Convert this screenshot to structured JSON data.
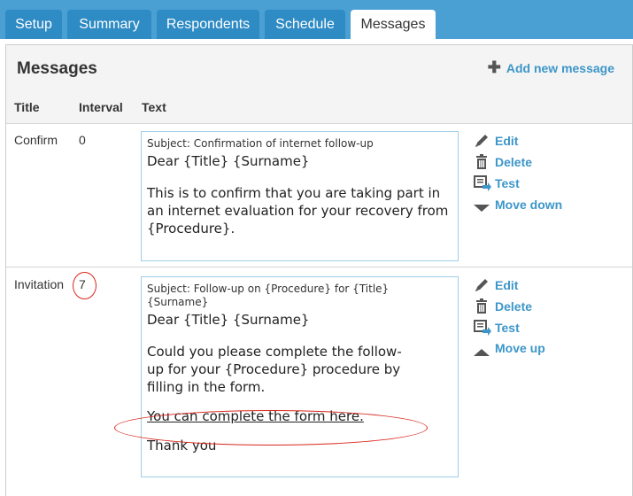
{
  "tabs": [
    {
      "label": "Setup"
    },
    {
      "label": "Summary"
    },
    {
      "label": "Respondents"
    },
    {
      "label": "Schedule"
    },
    {
      "label": "Messages"
    }
  ],
  "page": {
    "heading": "Messages",
    "add_new": "Add new message"
  },
  "columns": {
    "title": "Title",
    "interval": "Interval",
    "text": "Text"
  },
  "rows": [
    {
      "title": "Confirm",
      "interval": "0",
      "subject": "Subject: Confirmation of internet follow-up",
      "greeting": "Dear {Title} {Surname}",
      "para1": "This is to confirm that you are taking part in an internet evaluation for your recovery from {Procedure}.",
      "actions": {
        "edit": "Edit",
        "delete": "Delete",
        "test": "Test",
        "move": "Move down"
      }
    },
    {
      "title": "Invitation",
      "interval": "7",
      "subject": "Subject: Follow-up on {Procedure} for {Title} {Surname}",
      "greeting": "Dear {Title} {Surname}",
      "para1": "Could you please complete the follow-up for your {Procedure} procedure  by filling in the form.",
      "link": "You can complete the form here.",
      "closing": "Thank you",
      "actions": {
        "edit": "Edit",
        "delete": "Delete",
        "test": "Test",
        "move": "Move up"
      }
    }
  ],
  "colors": {
    "topbar": "#4a9fd3",
    "tab": "#2e8bc4",
    "link": "#3d96c9",
    "annotation": "#d9261c"
  }
}
